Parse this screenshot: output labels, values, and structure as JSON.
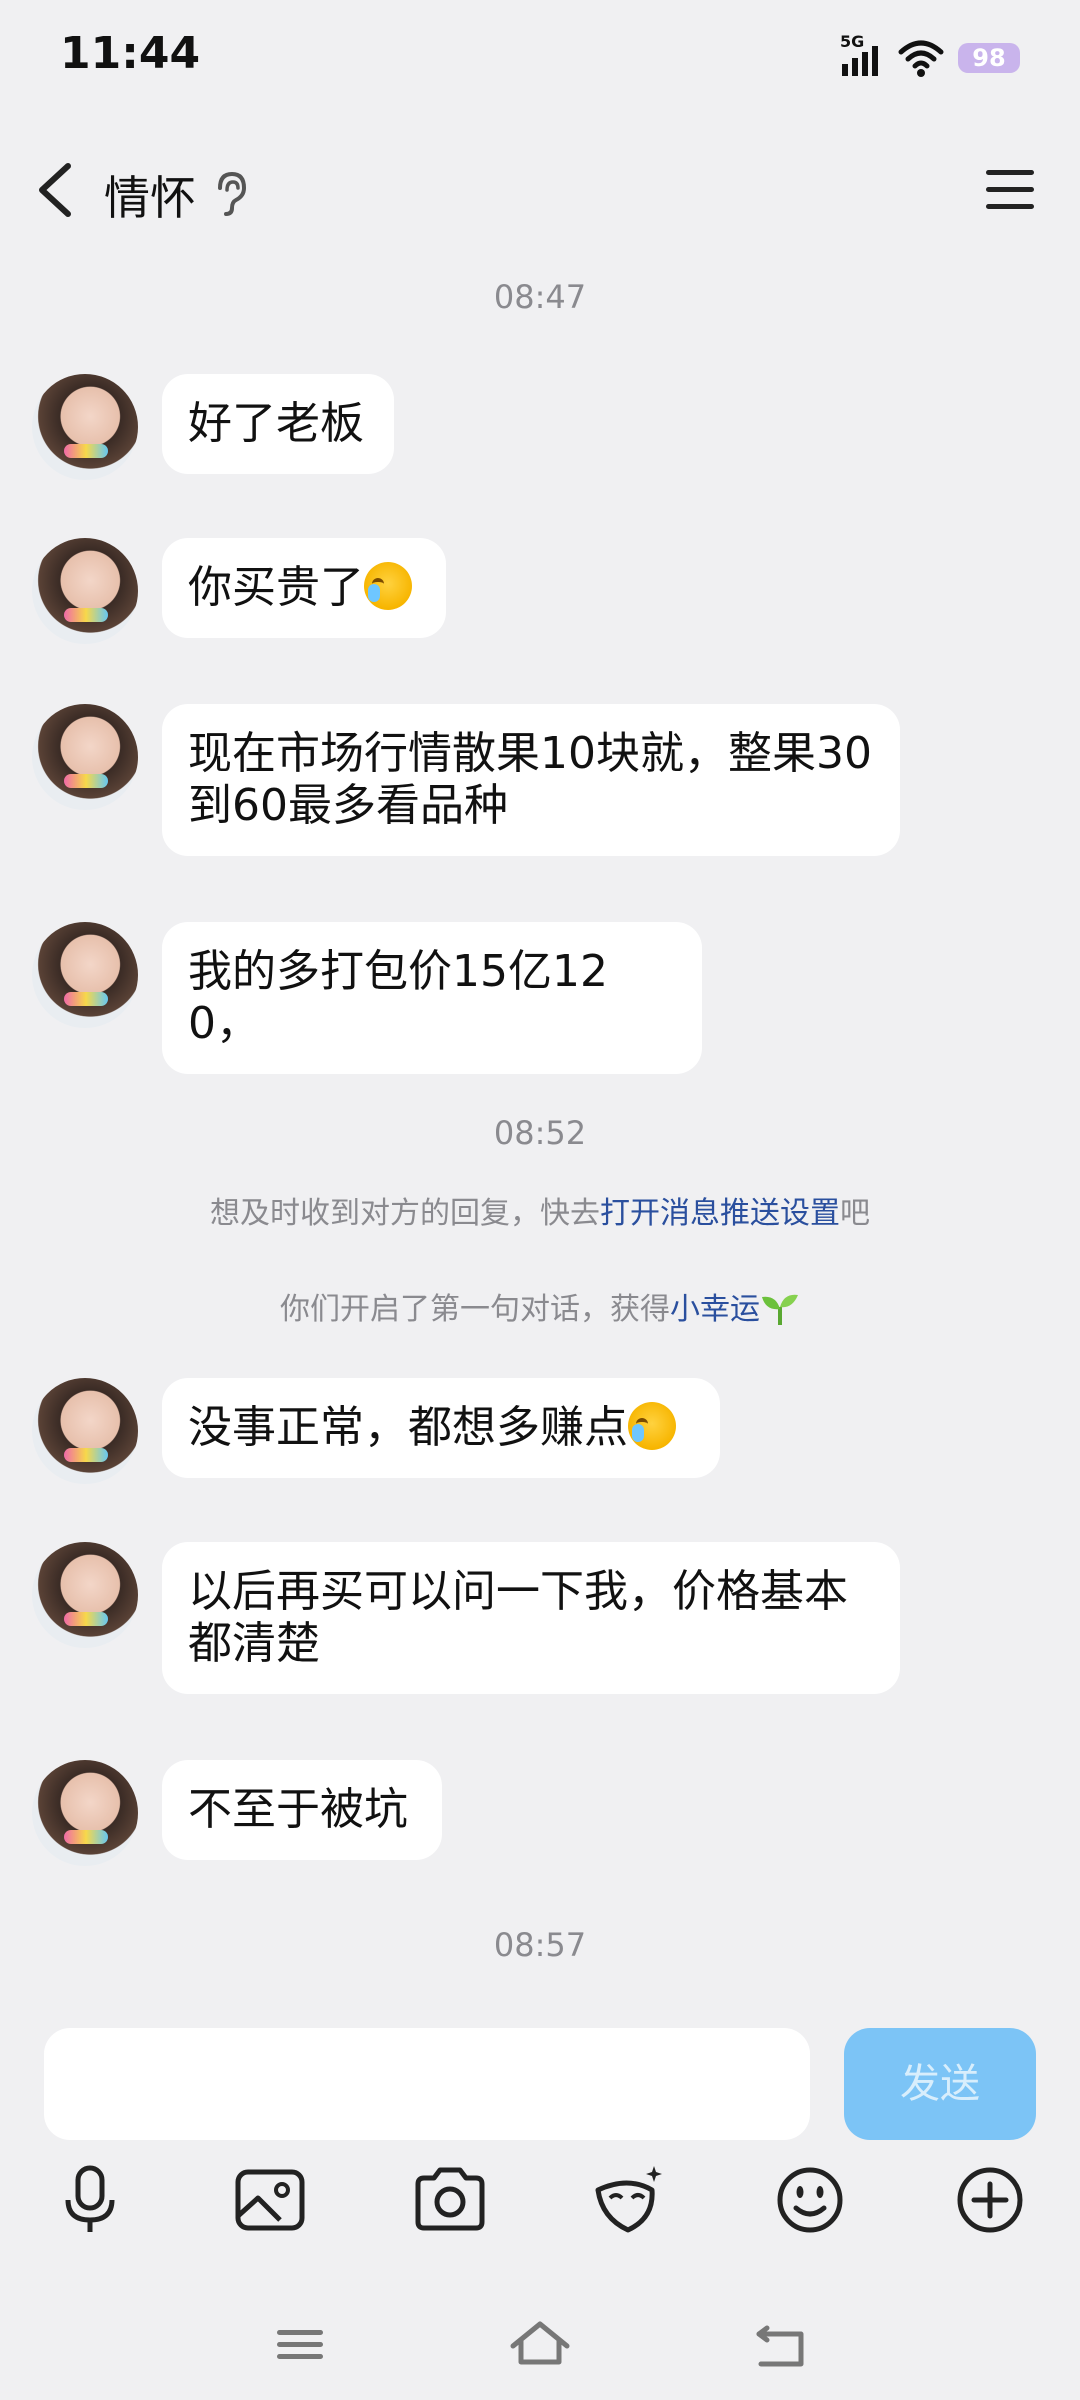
{
  "status_bar": {
    "time": "11:44",
    "network": "5G",
    "battery": "98"
  },
  "header": {
    "title": "情怀"
  },
  "messages": {
    "timestamp_1": "08:47",
    "m1": "好了老板",
    "m2": "你买贵了",
    "m3": "现在市场行情散果10块就，整果30到60最多看品种",
    "m4": "我的多打包价15亿120，",
    "timestamp_2": "08:52",
    "notice_1_prefix": "想及时收到对方的回复，快去",
    "notice_1_link": "打开消息推送设置",
    "notice_1_suffix": "吧",
    "notice_2_prefix": "你们开启了第一句对话，获得",
    "notice_2_link": "小幸运",
    "m5": "没事正常，都想多赚点",
    "m6": "以后再买可以问一下我，价格基本都清楚",
    "m7": "不至于被坑",
    "timestamp_3": "08:57"
  },
  "input": {
    "value": "",
    "send_label": "发送"
  },
  "icons": {
    "back": "chevron-left-icon",
    "ear": "ear-icon",
    "menu": "menu-icon",
    "emoji_in_message": "crying-face-emoji",
    "sprout": "sprout-icon",
    "tools": [
      "microphone-icon",
      "image-icon",
      "camera-icon",
      "mask-icon",
      "smiley-icon",
      "plus-circle-icon"
    ],
    "nav": [
      "recents-icon",
      "home-icon",
      "back-nav-icon"
    ]
  },
  "colors": {
    "background": "#f0f0f2",
    "bubble": "#ffffff",
    "link": "#2a4f9e",
    "send_button": "#7cc4f6",
    "timestamp": "#8a8a8f"
  }
}
